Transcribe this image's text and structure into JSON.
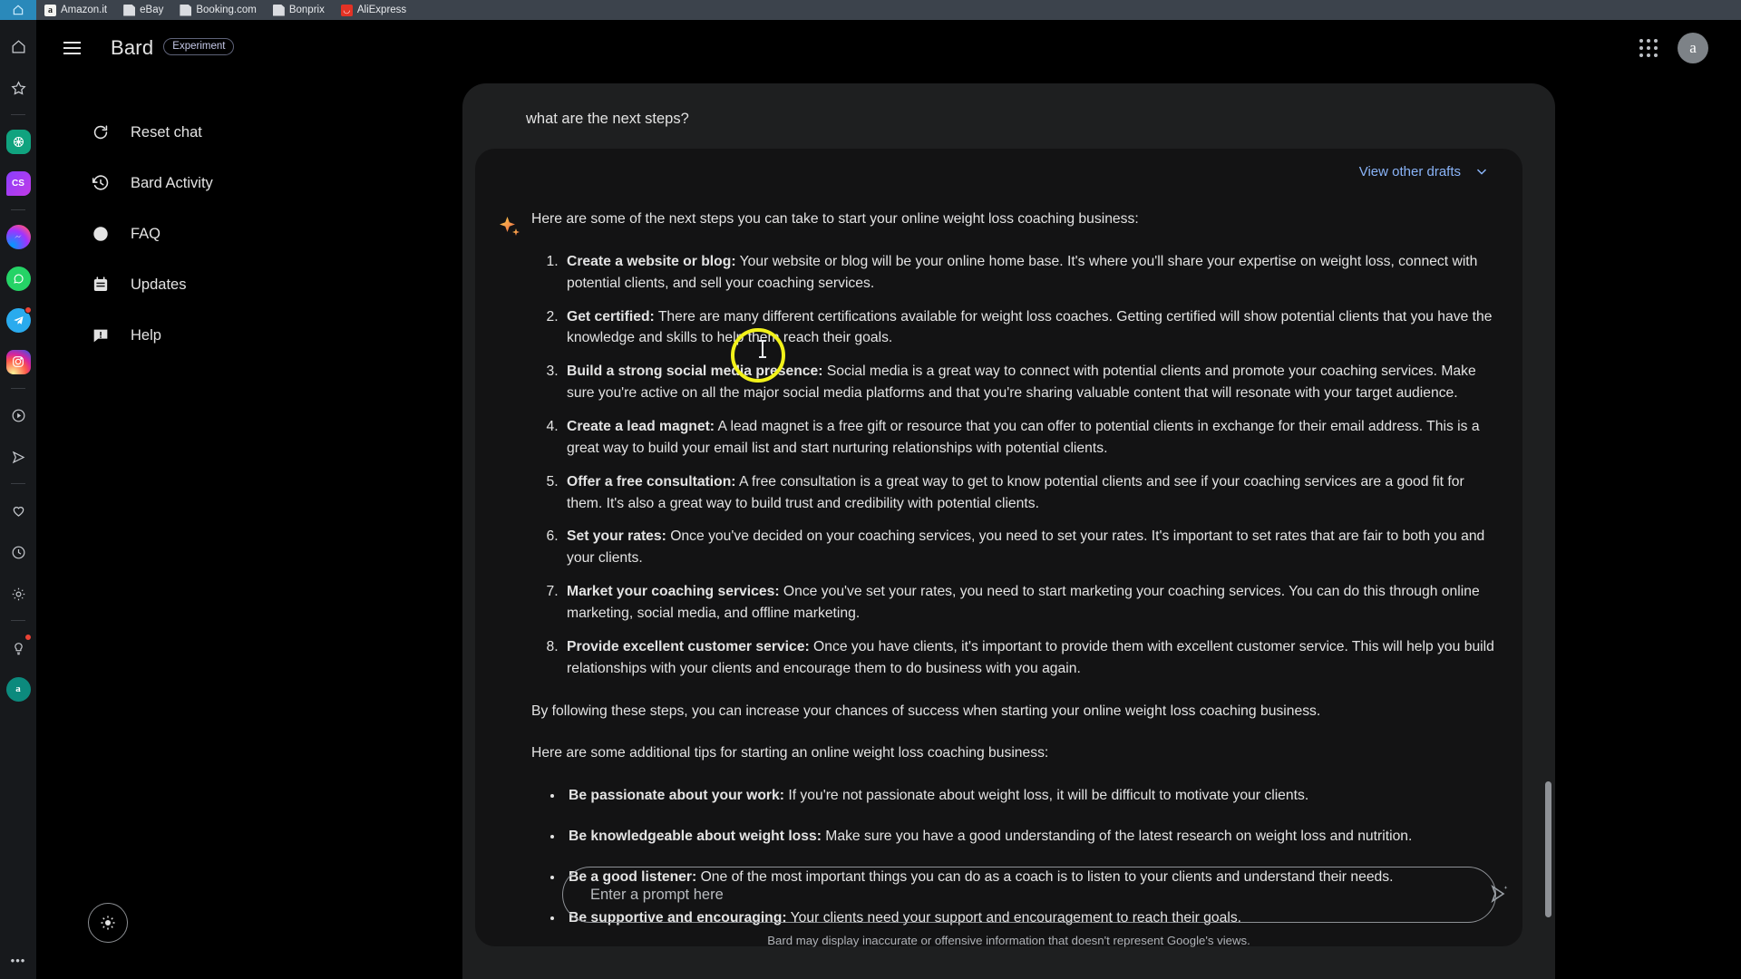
{
  "bookmarks": {
    "home_icon": "home-icon",
    "items": [
      {
        "label": "Amazon.it",
        "icon": "amazon-favicon",
        "glyph": "a"
      },
      {
        "label": "eBay",
        "icon": "generic-page-favicon",
        "glyph": ""
      },
      {
        "label": "Booking.com",
        "icon": "generic-page-favicon",
        "glyph": ""
      },
      {
        "label": "Bonprix",
        "icon": "generic-page-favicon",
        "glyph": ""
      },
      {
        "label": "AliExpress",
        "icon": "aliexpress-favicon",
        "glyph": "◡"
      }
    ]
  },
  "rail": {
    "items": [
      {
        "name": "home-icon",
        "badge": false
      },
      {
        "name": "star-icon",
        "badge": false
      },
      {
        "name": "divider",
        "badge": false
      },
      {
        "name": "openai-icon",
        "badge": false
      },
      {
        "name": "cs-app-icon",
        "badge": false,
        "glyph": "CS"
      },
      {
        "name": "divider",
        "badge": false
      },
      {
        "name": "messenger-icon",
        "badge": false
      },
      {
        "name": "whatsapp-icon",
        "badge": false
      },
      {
        "name": "telegram-icon",
        "badge": true
      },
      {
        "name": "instagram-icon",
        "badge": false
      },
      {
        "name": "divider",
        "badge": false
      },
      {
        "name": "play-circle-icon",
        "badge": false
      },
      {
        "name": "send-icon",
        "badge": false
      },
      {
        "name": "divider",
        "badge": false
      },
      {
        "name": "heart-icon",
        "badge": false
      },
      {
        "name": "clock-icon",
        "badge": false
      },
      {
        "name": "gear-icon",
        "badge": false
      },
      {
        "name": "divider",
        "badge": false
      },
      {
        "name": "lightbulb-icon",
        "badge": true
      },
      {
        "name": "amazon-icon",
        "badge": false,
        "glyph": "a"
      }
    ],
    "overflow_label": "•••"
  },
  "header": {
    "menu_icon": "hamburger-icon",
    "title": "Bard",
    "badge": "Experiment",
    "apps_icon": "apps-grid-icon",
    "avatar_initial": "a"
  },
  "sidebar": {
    "items": [
      {
        "label": "Reset chat",
        "icon": "reset-icon"
      },
      {
        "label": "Bard Activity",
        "icon": "history-icon"
      },
      {
        "label": "FAQ",
        "icon": "question-mark-icon"
      },
      {
        "label": "Updates",
        "icon": "calendar-icon"
      },
      {
        "label": "Help",
        "icon": "feedback-alert-icon"
      }
    ],
    "theme_toggle_icon": "brightness-sun-icon"
  },
  "conversation": {
    "user_prompt": "what are the next steps?",
    "drafts_label": "View other drafts",
    "drafts_chevron": "chevron-down-icon",
    "bard_icon": "bard-sparkle-icon",
    "intro": "Here are some of the next steps you can take to start your online weight loss coaching business:",
    "steps": [
      {
        "title": "Create a website or blog:",
        "text": " Your website or blog will be your online home base. It's where you'll share your expertise on weight loss, connect with potential clients, and sell your coaching services."
      },
      {
        "title": "Get certified:",
        "text": " There are many different certifications available for weight loss coaches. Getting certified will show potential clients that you have the knowledge and skills to help them reach their goals."
      },
      {
        "title": "Build a strong social media presence:",
        "text": " Social media is a great way to connect with potential clients and promote your coaching services. Make sure you're active on all the major social media platforms and that you're sharing valuable content that will resonate with your target audience."
      },
      {
        "title": "Create a lead magnet:",
        "text": " A lead magnet is a free gift or resource that you can offer to potential clients in exchange for their email address. This is a great way to build your email list and start nurturing relationships with potential clients."
      },
      {
        "title": "Offer a free consultation:",
        "text": " A free consultation is a great way to get to know potential clients and see if your coaching services are a good fit for them. It's also a great way to build trust and credibility with potential clients."
      },
      {
        "title": "Set your rates:",
        "text": " Once you've decided on your coaching services, you need to set your rates. It's important to set rates that are fair to both you and your clients."
      },
      {
        "title": "Market your coaching services:",
        "text": " Once you've set your rates, you need to start marketing your coaching services. You can do this through online marketing, social media, and offline marketing."
      },
      {
        "title": "Provide excellent customer service:",
        "text": " Once you have clients, it's important to provide them with excellent customer service. This will help you build relationships with your clients and encourage them to do business with you again."
      }
    ],
    "closing": "By following these steps, you can increase your chances of success when starting your online weight loss coaching business.",
    "tips_intro": "Here are some additional tips for starting an online weight loss coaching business:",
    "tips": [
      {
        "title": "Be passionate about your work:",
        "text": " If you're not passionate about weight loss, it will be difficult to motivate your clients."
      },
      {
        "title": "Be knowledgeable about weight loss:",
        "text": " Make sure you have a good understanding of the latest research on weight loss and nutrition."
      },
      {
        "title": "Be a good listener:",
        "text": " One of the most important things you can do as a coach is to listen to your clients and understand their needs."
      },
      {
        "title": "Be supportive and encouraging:",
        "text": " Your clients need your support and encouragement to reach their goals."
      }
    ]
  },
  "composer": {
    "placeholder": "Enter a prompt here",
    "value": "",
    "send_icon": "send-sparkle-icon"
  },
  "footer": {
    "disclaimer": "Bard may display inaccurate or offensive information that doesn't represent Google's views."
  },
  "colors": {
    "page_bg": "#000000",
    "panel_bg": "#1e1f20",
    "card_bg": "#131314",
    "accent_link": "#8ab4f8",
    "text": "#e3e3e3",
    "cursor_highlight": "#f2f21a"
  }
}
